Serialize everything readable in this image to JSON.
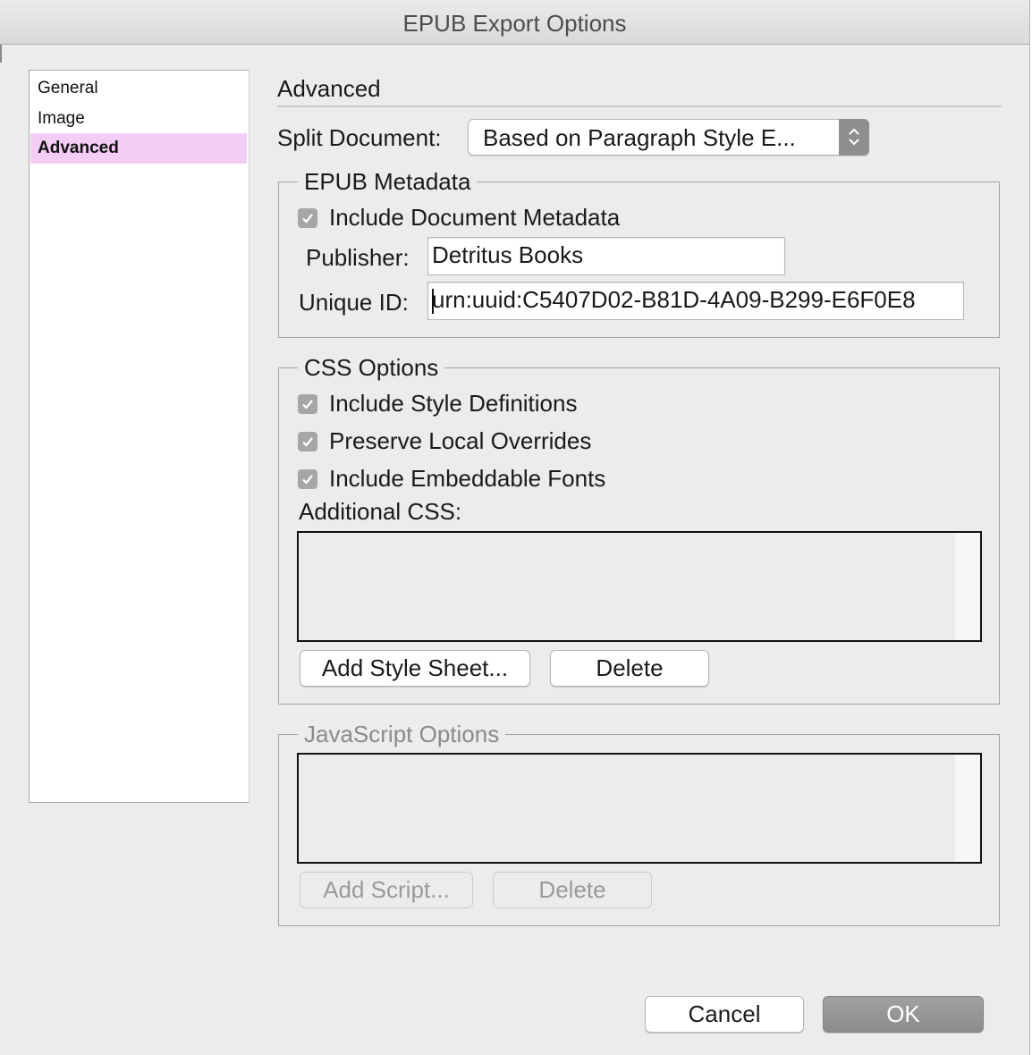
{
  "window": {
    "title": "EPUB Export Options"
  },
  "sidebar": {
    "items": [
      {
        "label": "General"
      },
      {
        "label": "Image"
      },
      {
        "label": "Advanced",
        "selected": true
      }
    ],
    "selected_color": "#f4cdf7"
  },
  "section": {
    "title": "Advanced"
  },
  "split_document": {
    "label": "Split Document:",
    "value": "Based on Paragraph Style E..."
  },
  "epub_metadata": {
    "group_title": "EPUB Metadata",
    "include_metadata": {
      "label": "Include Document Metadata",
      "checked": true
    },
    "publisher": {
      "label": "Publisher:",
      "value": "Detritus Books"
    },
    "unique_id": {
      "label": "Unique ID:",
      "value": "urn:uuid:C5407D02-B81D-4A09-B299-E6F0E8"
    }
  },
  "css_options": {
    "group_title": "CSS Options",
    "include_style_definitions": {
      "label": "Include Style Definitions",
      "checked": true
    },
    "preserve_local_overrides": {
      "label": "Preserve Local Overrides",
      "checked": true
    },
    "include_embeddable_fonts": {
      "label": "Include Embeddable Fonts",
      "checked": true
    },
    "additional_css_label": "Additional CSS:",
    "add_style_sheet_button": "Add Style Sheet...",
    "delete_button": "Delete"
  },
  "javascript_options": {
    "group_title": "JavaScript Options",
    "add_script_button": "Add Script...",
    "delete_button": "Delete",
    "enabled": false
  },
  "footer": {
    "cancel_button": "Cancel",
    "ok_button": "OK"
  }
}
